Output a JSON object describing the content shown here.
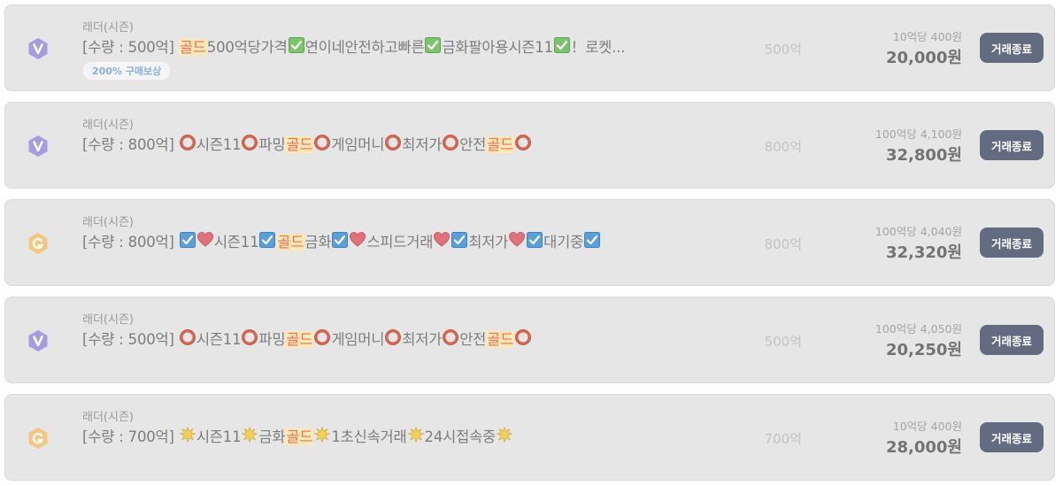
{
  "colors": {
    "card_bg": "#e6e6e6",
    "highlight_bg": "#fbe9b6",
    "highlight_text": "#ef6b5b",
    "button_bg": "#626b80",
    "badge_v": "#a99be0",
    "badge_g": "#f5c67e"
  },
  "listings": [
    {
      "badge_icon": "v-grade-icon",
      "server": "래더(시즌)",
      "title_parts": [
        {
          "type": "text",
          "value": "[수량 : 500억] "
        },
        {
          "type": "highlight",
          "value": "골드"
        },
        {
          "type": "text",
          "value": "500억당가격"
        },
        {
          "type": "icon",
          "icon": "green-check-icon"
        },
        {
          "type": "text",
          "value": "연이네안전하고빠른"
        },
        {
          "type": "icon",
          "icon": "green-check-icon"
        },
        {
          "type": "text",
          "value": "금화팔아용시즌11"
        },
        {
          "type": "icon",
          "icon": "green-check-icon"
        },
        {
          "type": "text",
          "value": "！로켓..."
        }
      ],
      "reward_badge": "200% 구매보상",
      "quantity": "500억",
      "unit_price": "10억당 400원",
      "price": "20,000원",
      "status_label": "거래종료"
    },
    {
      "badge_icon": "v-grade-icon",
      "server": "래더(시즌)",
      "title_parts": [
        {
          "type": "text",
          "value": "[수량 : 800억] "
        },
        {
          "type": "icon",
          "icon": "red-circle-icon"
        },
        {
          "type": "text",
          "value": "시즌11"
        },
        {
          "type": "icon",
          "icon": "red-circle-icon"
        },
        {
          "type": "text",
          "value": "파밍"
        },
        {
          "type": "highlight",
          "value": "골드"
        },
        {
          "type": "icon",
          "icon": "red-circle-icon"
        },
        {
          "type": "text",
          "value": "게임머니"
        },
        {
          "type": "icon",
          "icon": "red-circle-icon"
        },
        {
          "type": "text",
          "value": "최저가"
        },
        {
          "type": "icon",
          "icon": "red-circle-icon"
        },
        {
          "type": "text",
          "value": "안전"
        },
        {
          "type": "highlight",
          "value": "골드"
        },
        {
          "type": "icon",
          "icon": "red-circle-icon"
        }
      ],
      "reward_badge": "",
      "quantity": "800억",
      "unit_price": "100억당 4,100원",
      "price": "32,800원",
      "status_label": "거래종료"
    },
    {
      "badge_icon": "g-grade-icon",
      "server": "래더(시즌)",
      "title_parts": [
        {
          "type": "text",
          "value": "[수량 : 800억] "
        },
        {
          "type": "icon",
          "icon": "blue-check-icon"
        },
        {
          "type": "icon",
          "icon": "heart-icon"
        },
        {
          "type": "text",
          "value": "시즌11"
        },
        {
          "type": "icon",
          "icon": "blue-check-icon"
        },
        {
          "type": "highlight",
          "value": "골드"
        },
        {
          "type": "text",
          "value": "금화"
        },
        {
          "type": "icon",
          "icon": "blue-check-icon"
        },
        {
          "type": "icon",
          "icon": "heart-icon"
        },
        {
          "type": "text",
          "value": "스피드거래"
        },
        {
          "type": "icon",
          "icon": "heart-icon"
        },
        {
          "type": "icon",
          "icon": "blue-check-icon"
        },
        {
          "type": "text",
          "value": "최저가"
        },
        {
          "type": "icon",
          "icon": "heart-icon"
        },
        {
          "type": "icon",
          "icon": "blue-check-icon"
        },
        {
          "type": "text",
          "value": "대기중"
        },
        {
          "type": "icon",
          "icon": "blue-check-icon"
        }
      ],
      "reward_badge": "",
      "quantity": "800억",
      "unit_price": "100억당 4,040원",
      "price": "32,320원",
      "status_label": "거래종료"
    },
    {
      "badge_icon": "v-grade-icon",
      "server": "래더(시즌)",
      "title_parts": [
        {
          "type": "text",
          "value": "[수량 : 500억] "
        },
        {
          "type": "icon",
          "icon": "red-circle-icon"
        },
        {
          "type": "text",
          "value": "시즌11"
        },
        {
          "type": "icon",
          "icon": "red-circle-icon"
        },
        {
          "type": "text",
          "value": "파밍"
        },
        {
          "type": "highlight",
          "value": "골드"
        },
        {
          "type": "icon",
          "icon": "red-circle-icon"
        },
        {
          "type": "text",
          "value": "게임머니"
        },
        {
          "type": "icon",
          "icon": "red-circle-icon"
        },
        {
          "type": "text",
          "value": "최저가"
        },
        {
          "type": "icon",
          "icon": "red-circle-icon"
        },
        {
          "type": "text",
          "value": "안전"
        },
        {
          "type": "highlight",
          "value": "골드"
        },
        {
          "type": "icon",
          "icon": "red-circle-icon"
        }
      ],
      "reward_badge": "",
      "quantity": "500억",
      "unit_price": "100억당 4,050원",
      "price": "20,250원",
      "status_label": "거래종료"
    },
    {
      "badge_icon": "g-grade-icon",
      "server": "래더(시즌)",
      "title_parts": [
        {
          "type": "text",
          "value": "[수량 : 700억] "
        },
        {
          "type": "icon",
          "icon": "sparkle-icon"
        },
        {
          "type": "text",
          "value": "시즌11"
        },
        {
          "type": "icon",
          "icon": "sparkle-icon"
        },
        {
          "type": "text",
          "value": "금화"
        },
        {
          "type": "highlight",
          "value": "골드"
        },
        {
          "type": "icon",
          "icon": "sparkle-icon"
        },
        {
          "type": "text",
          "value": "1초신속거래"
        },
        {
          "type": "icon",
          "icon": "sparkle-icon"
        },
        {
          "type": "text",
          "value": "24시접속중"
        },
        {
          "type": "icon",
          "icon": "sparkle-icon"
        }
      ],
      "reward_badge": "",
      "quantity": "700억",
      "unit_price": "10억당 400원",
      "price": "28,000원",
      "status_label": "거래종료"
    }
  ]
}
